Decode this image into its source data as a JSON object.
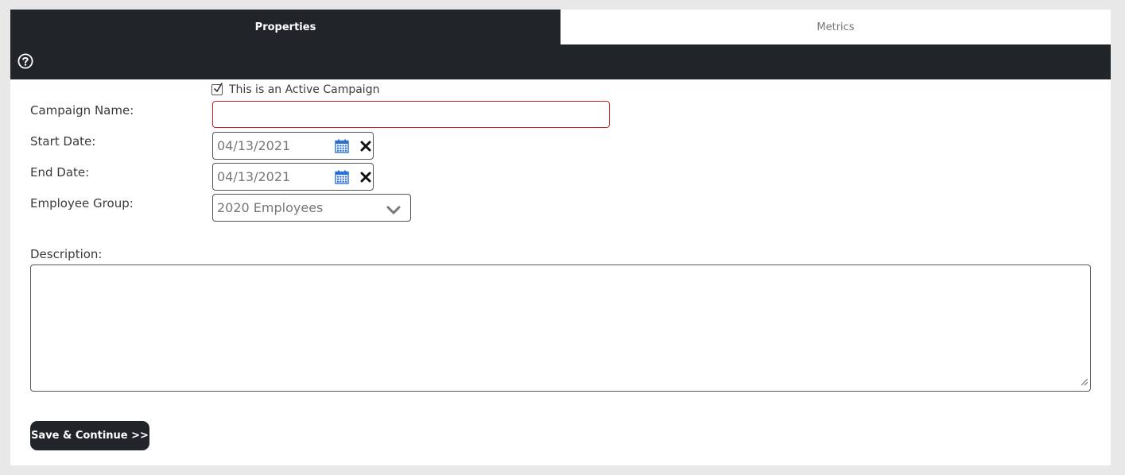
{
  "tabs": [
    {
      "label": "Properties",
      "active": true
    },
    {
      "label": "Metrics",
      "active": false
    }
  ],
  "toolbar": {
    "help_icon": "question-circle-icon"
  },
  "form": {
    "active_checkbox": {
      "label": "This is an Active Campaign",
      "checked": true
    },
    "campaign_name": {
      "label": "Campaign Name:",
      "value": ""
    },
    "start_date": {
      "label": "Start Date:",
      "value": "04/13/2021"
    },
    "end_date": {
      "label": "End Date:",
      "value": "04/13/2021"
    },
    "employee_group": {
      "label": "Employee Group:",
      "value": "2020 Employees"
    },
    "description": {
      "label": "Description:",
      "value": ""
    }
  },
  "actions": {
    "save_label": "Save & Continue >>"
  },
  "colors": {
    "dark": "#212529",
    "error_border": "#cc1f1f",
    "calendar_icon": "#2b6fd6",
    "page_bg": "#e8e8e8"
  }
}
